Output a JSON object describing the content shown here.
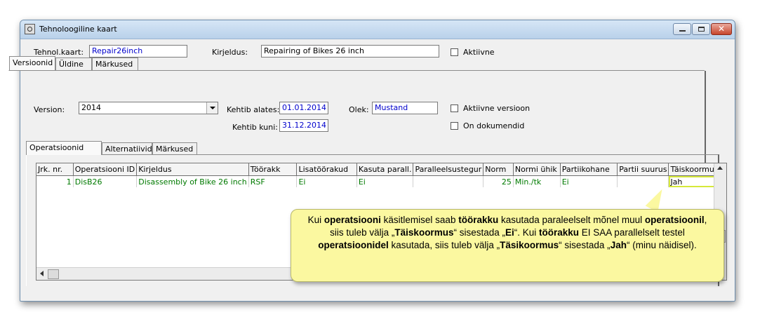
{
  "window": {
    "title": "Tehnoloogiline kaart"
  },
  "header": {
    "tehn_label": "Tehnol.kaart:",
    "tehn_value": "Repair26inch",
    "kirjeldus_label": "Kirjeldus:",
    "kirjeldus_value": "Repairing of Bikes 26 inch",
    "aktiivne_label": "Aktiivne"
  },
  "tabs_top": [
    "Versioonid",
    "Üldine",
    "Märkused"
  ],
  "version": {
    "version_label": "Version:",
    "version_value": "2014",
    "alates_label": "Kehtib alates:",
    "alates_value": "01.01.2014",
    "kuni_label": "Kehtib kuni:",
    "kuni_value": "31.12.2014",
    "olek_label": "Olek:",
    "olek_value": "Mustand",
    "aktiivne_versioon_label": "Aktiivne versioon",
    "on_dokumendid_label": "On dokumendid"
  },
  "tabs_inner": [
    "Operatsioonid",
    "Alternatiivid",
    "Märkused"
  ],
  "grid": {
    "columns": [
      "Jrk. nr.",
      "Operatsiooni ID",
      "Kirjeldus",
      "Töörakk",
      "Lisatöörakud",
      "Kasuta parall.",
      "Paralleelsustegur",
      "Norm",
      "Normi ühik",
      "Partiikohane",
      "Partii suurus",
      "Täiskoormus"
    ],
    "rows": [
      [
        "1",
        "DisB26",
        "Disassembly of Bike 26 inch",
        "RSF",
        "Ei",
        "Ei",
        "",
        "25",
        "Min./tk",
        "Ei",
        "",
        "Jah"
      ]
    ]
  },
  "callout": {
    "p1": "Kui ",
    "b1": "operatsiooni",
    "p2": " käsitlemisel saab ",
    "b2": "töörakku",
    "p3": " kasutada paraleelselt mõnel muul ",
    "b3": "operatsioonil",
    "p4": ", siis tuleb välja „",
    "b4": "Täiskoormus",
    "p5": "“ sisestada „",
    "b5": "Ei",
    "p6": "“.  Kui ",
    "b6": "töörakku",
    "p7": " EI SAA parallelselt testel ",
    "b7": "operatsioonidel",
    "p8": " kasutada, siis tuleb välja „",
    "b8": "Täsikoormus",
    "p9": "“ sisestada „",
    "b9": "Jah",
    "p10": "“ (minu näidisel)."
  }
}
